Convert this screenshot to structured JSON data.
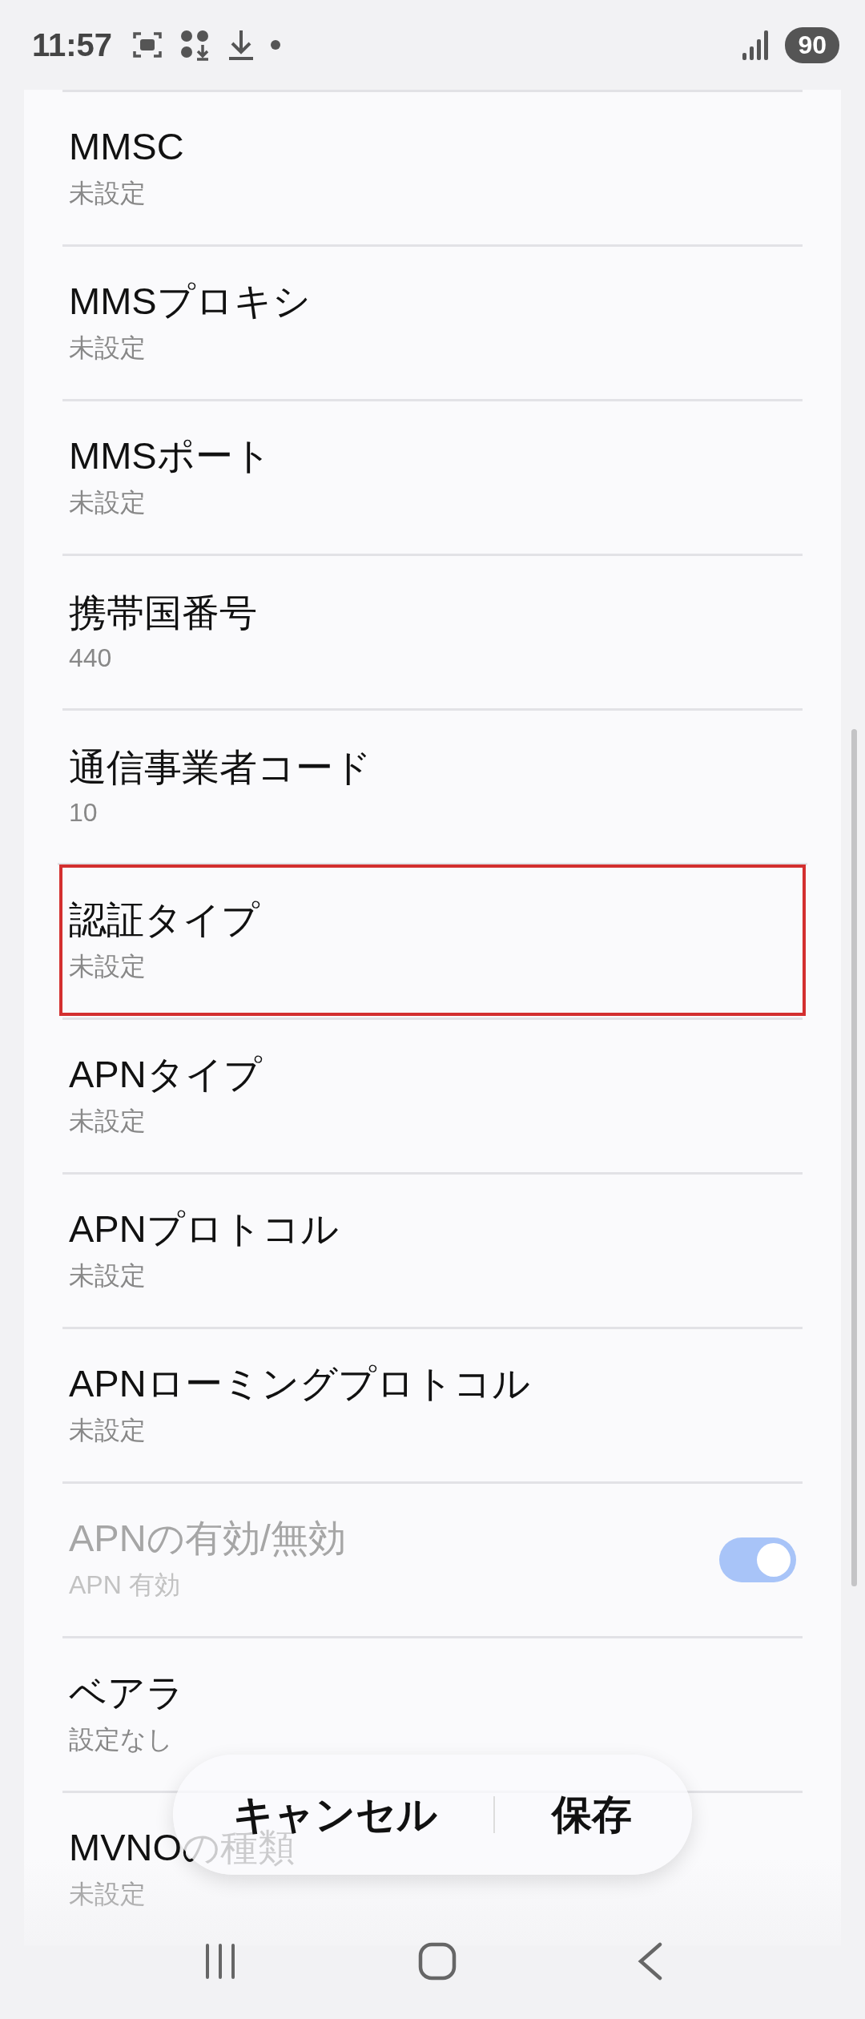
{
  "status_bar": {
    "time": "11:57",
    "battery": "90"
  },
  "rows": [
    {
      "title": "MMSC",
      "value": "未設定",
      "highlighted": false,
      "disabled": false,
      "kind": "text"
    },
    {
      "title": "MMSプロキシ",
      "value": "未設定",
      "highlighted": false,
      "disabled": false,
      "kind": "text"
    },
    {
      "title": "MMSポート",
      "value": "未設定",
      "highlighted": false,
      "disabled": false,
      "kind": "text"
    },
    {
      "title": "携帯国番号",
      "value": "440",
      "highlighted": false,
      "disabled": false,
      "kind": "text"
    },
    {
      "title": "通信事業者コード",
      "value": "10",
      "highlighted": false,
      "disabled": false,
      "kind": "text"
    },
    {
      "title": "認証タイプ",
      "value": "未設定",
      "highlighted": true,
      "disabled": false,
      "kind": "text"
    },
    {
      "title": "APNタイプ",
      "value": "未設定",
      "highlighted": false,
      "disabled": false,
      "kind": "text"
    },
    {
      "title": "APNプロトコル",
      "value": "未設定",
      "highlighted": false,
      "disabled": false,
      "kind": "text"
    },
    {
      "title": "APNローミングプロトコル",
      "value": "未設定",
      "highlighted": false,
      "disabled": false,
      "kind": "text"
    },
    {
      "title": "APNの有効/無効",
      "value": "APN 有効",
      "highlighted": false,
      "disabled": true,
      "kind": "toggle",
      "on": true
    },
    {
      "title": "ベアラ",
      "value": "設定なし",
      "highlighted": false,
      "disabled": false,
      "kind": "text"
    },
    {
      "title": "MVNOの種類",
      "value": "未設定",
      "highlighted": false,
      "disabled": false,
      "kind": "text"
    }
  ],
  "actions": [
    {
      "label": "キャンセル"
    },
    {
      "label": "保存"
    }
  ]
}
